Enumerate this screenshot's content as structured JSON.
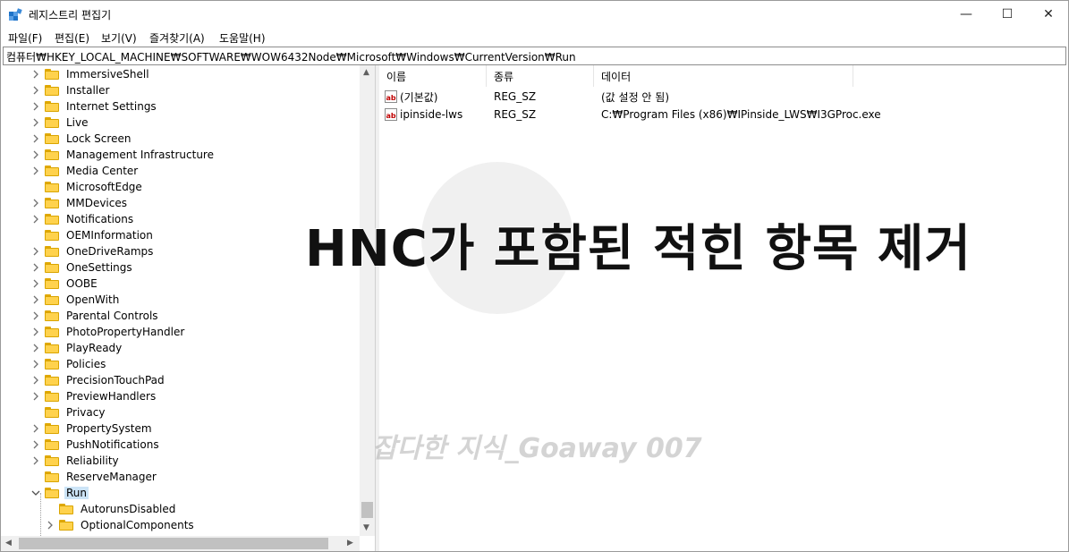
{
  "window": {
    "title": "레지스트리 편집기",
    "minimize_glyph": "—",
    "maximize_glyph": "☐",
    "close_glyph": "✕"
  },
  "menu": [
    "파일(F)",
    "편집(E)",
    "보기(V)",
    "즐겨찾기(A)",
    "도움말(H)"
  ],
  "address": "컴퓨터₩HKEY_LOCAL_MACHINE₩SOFTWARE₩WOW6432Node₩Microsoft₩Windows₩CurrentVersion₩Run",
  "tree": {
    "items": [
      {
        "label": "ImmersiveShell",
        "expander": true
      },
      {
        "label": "Installer",
        "expander": true
      },
      {
        "label": "Internet Settings",
        "expander": true
      },
      {
        "label": "Live",
        "expander": true
      },
      {
        "label": "Lock Screen",
        "expander": true
      },
      {
        "label": "Management Infrastructure",
        "expander": true
      },
      {
        "label": "Media Center",
        "expander": true
      },
      {
        "label": "MicrosoftEdge",
        "expander": false
      },
      {
        "label": "MMDevices",
        "expander": true
      },
      {
        "label": "Notifications",
        "expander": true
      },
      {
        "label": "OEMInformation",
        "expander": false
      },
      {
        "label": "OneDriveRamps",
        "expander": true
      },
      {
        "label": "OneSettings",
        "expander": true
      },
      {
        "label": "OOBE",
        "expander": true
      },
      {
        "label": "OpenWith",
        "expander": true
      },
      {
        "label": "Parental Controls",
        "expander": true
      },
      {
        "label": "PhotoPropertyHandler",
        "expander": true
      },
      {
        "label": "PlayReady",
        "expander": true
      },
      {
        "label": "Policies",
        "expander": true
      },
      {
        "label": "PrecisionTouchPad",
        "expander": true
      },
      {
        "label": "PreviewHandlers",
        "expander": true
      },
      {
        "label": "Privacy",
        "expander": false
      },
      {
        "label": "PropertySystem",
        "expander": true
      },
      {
        "label": "PushNotifications",
        "expander": true
      },
      {
        "label": "Reliability",
        "expander": true
      },
      {
        "label": "ReserveManager",
        "expander": false
      },
      {
        "label": "Run",
        "expander": "open",
        "selected": true
      },
      {
        "label": "AutorunsDisabled",
        "expander": false,
        "child": true
      },
      {
        "label": "OptionalComponents",
        "expander": true,
        "child": true
      }
    ]
  },
  "list": {
    "columns": [
      "이름",
      "종류",
      "데이터"
    ],
    "rows": [
      {
        "name": "(기본값)",
        "type": "REG_SZ",
        "data": "(값 설정 안 됨)"
      },
      {
        "name": "ipinside-lws",
        "type": "REG_SZ",
        "data": "C:₩Program Files (x86)₩IPinside_LWS₩I3GProc.exe"
      }
    ],
    "value_icon_text": "ab"
  },
  "overlay": {
    "caption": "HNC가 포함된 적힌 항목 제거",
    "watermark": "잡다한 지식_Goaway 007"
  }
}
